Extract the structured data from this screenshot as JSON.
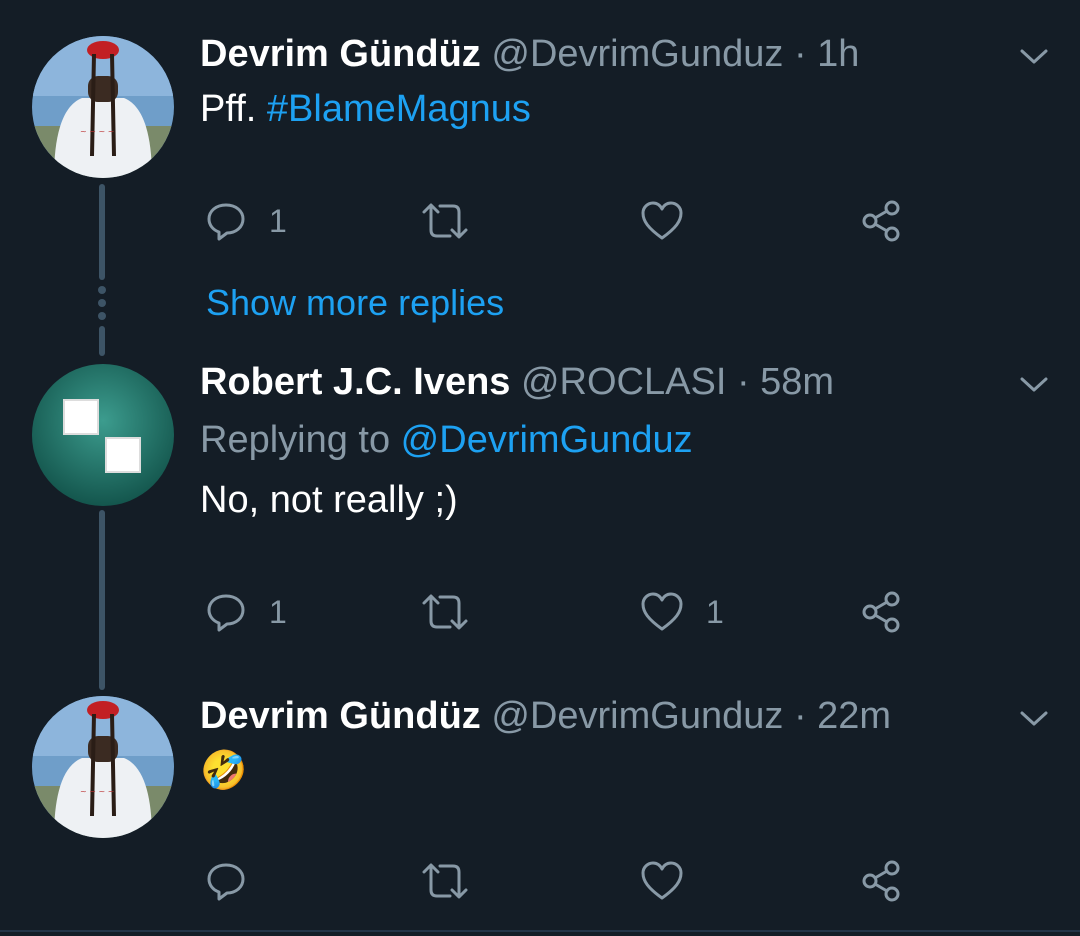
{
  "tweets": [
    {
      "name": "Devrim Gündüz",
      "handle": "@DevrimGunduz",
      "time": "· 1h",
      "text_prefix": "Pff. ",
      "hashtag": "#BlameMagnus",
      "reply_count": "1",
      "like_count": ""
    },
    {
      "name": "Robert J.C. Ivens",
      "handle": "@ROCLASI",
      "time": "· 58m",
      "replying_label": "Replying to ",
      "replying_handle": "@DevrimGunduz",
      "text": "No, not really  ;)",
      "reply_count": "1",
      "like_count": "1"
    },
    {
      "name": "Devrim Gündüz",
      "handle": "@DevrimGunduz",
      "time": "· 22m",
      "emoji": "🤣",
      "reply_count": "",
      "like_count": ""
    }
  ],
  "show_more": "Show more replies",
  "colors": {
    "background": "#141d26",
    "accent": "#1da1f2",
    "muted": "#8899a6",
    "thread_line": "#3d5466"
  },
  "icons": [
    "reply-icon",
    "retweet-icon",
    "like-icon",
    "share-icon",
    "chevron-down-icon"
  ]
}
